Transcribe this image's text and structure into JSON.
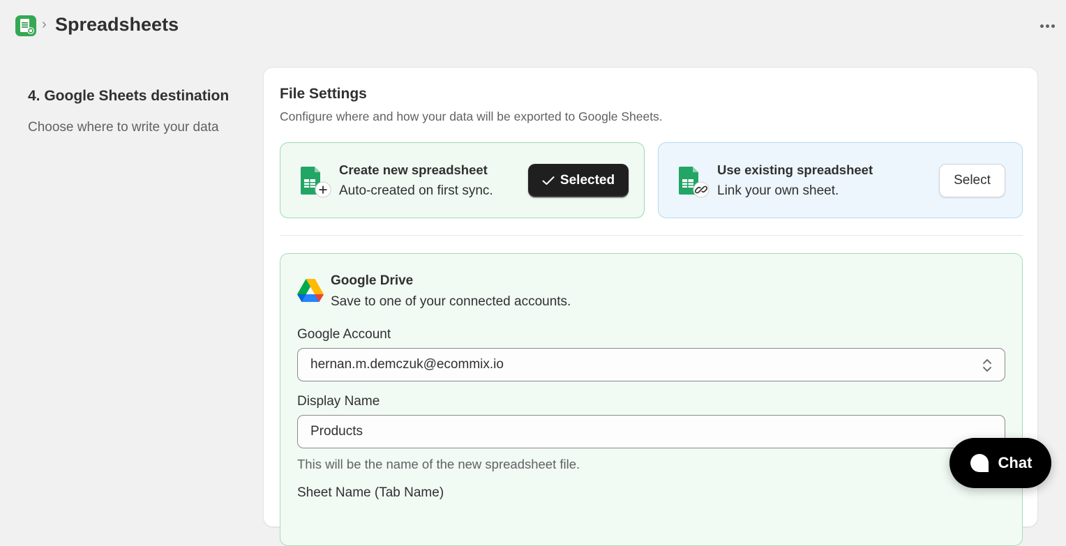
{
  "header": {
    "title": "Spreadsheets",
    "breadcrumb_separator": "›",
    "app_icon": "google-sheets-app-icon",
    "more_icon": "ellipsis-icon"
  },
  "section": {
    "heading": "4. Google Sheets destination",
    "description": "Choose where to write your data"
  },
  "file_settings": {
    "title": "File Settings",
    "subtitle": "Configure where and how your data will be exported to Google Sheets.",
    "options": [
      {
        "title": "Create new spreadsheet",
        "description": "Auto-created on first sync.",
        "button_label": "Selected",
        "selected": true,
        "icon": "sheet-plus-icon"
      },
      {
        "title": "Use existing spreadsheet",
        "description": "Link your own sheet.",
        "button_label": "Select",
        "selected": false,
        "icon": "sheet-link-icon"
      }
    ]
  },
  "google_drive": {
    "title": "Google Drive",
    "description": "Save to one of your connected accounts.",
    "account_label": "Google Account",
    "account_value": "hernan.m.demczuk@ecommix.io",
    "display_name_label": "Display Name",
    "display_name_value": "Products",
    "display_name_help": "This will be the name of the new spreadsheet file.",
    "sheet_name_label": "Sheet Name (Tab Name)"
  },
  "chat": {
    "label": "Chat"
  },
  "colors": {
    "selected_option_bg": "#f0faf3",
    "existing_option_bg": "#edf6fd",
    "sheets_green": "#1e8e3e",
    "primary_button": "#1f1f1f"
  }
}
